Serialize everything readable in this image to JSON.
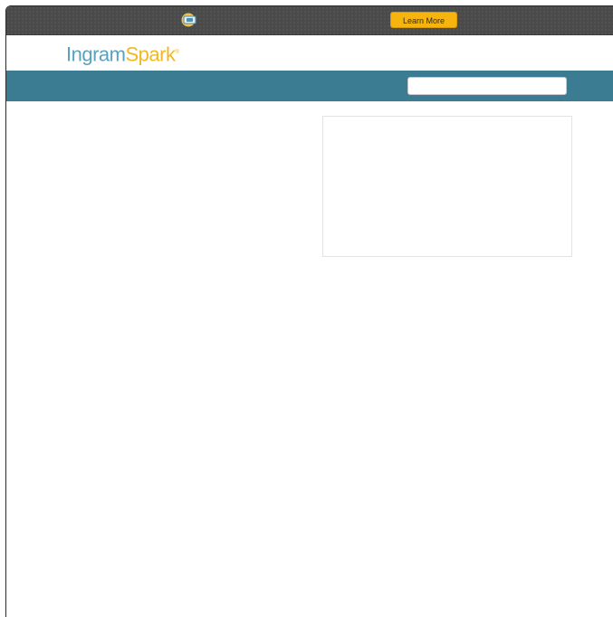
{
  "promo_bar": {
    "icon": "ticket-icon",
    "cta_label": "Learn More",
    "cta_color": "#f6b40e"
  },
  "header": {
    "logo_part1": "Ingram",
    "logo_part2": "Spark",
    "logo_mark": "®",
    "logo_color_primary": "#5aa0bf",
    "logo_color_accent": "#f1b823"
  },
  "nav": {
    "background": "#3b7c92",
    "search_value": ""
  }
}
